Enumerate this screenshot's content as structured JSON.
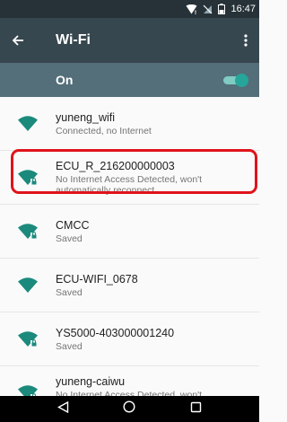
{
  "status_bar": {
    "time": "16:47"
  },
  "app_bar": {
    "title": "Wi-Fi"
  },
  "toggle": {
    "label": "On",
    "enabled": true
  },
  "networks": [
    {
      "ssid": "yuneng_wifi",
      "status": "Connected, no Internet",
      "icon": "wifi-icon"
    },
    {
      "ssid": "ECU_R_216200000003",
      "status": "No Internet Access Detected, won't automatically reconnect.",
      "icon": "wifi-locked-icon"
    },
    {
      "ssid": "CMCC",
      "status": "Saved",
      "icon": "wifi-locked-icon"
    },
    {
      "ssid": "ECU-WIFI_0678",
      "status": "Saved",
      "icon": "wifi-icon"
    },
    {
      "ssid": "YS5000-403000001240",
      "status": "Saved",
      "icon": "wifi-locked-icon"
    },
    {
      "ssid": "yuneng-caiwu",
      "status": "No Internet Access Detected, won't automatically reconnect.",
      "icon": "wifi-locked-icon"
    }
  ],
  "colors": {
    "accent": "#26a69a",
    "highlight": "#e0131b",
    "app_bar": "#37474f",
    "toggle_bar": "#546e7a"
  }
}
